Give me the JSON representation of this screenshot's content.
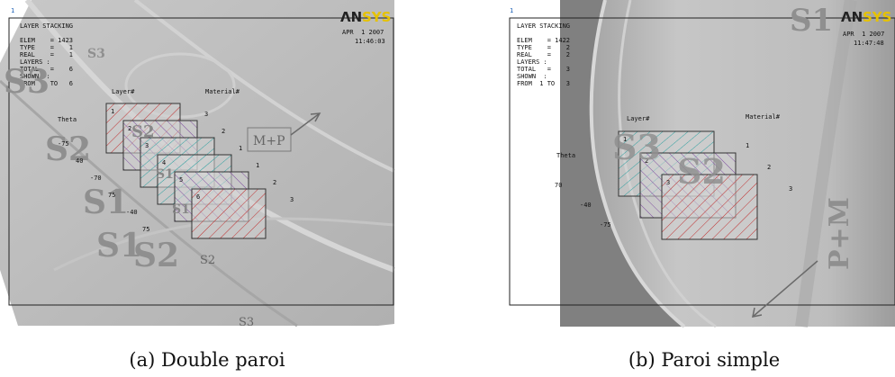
{
  "panels": [
    {
      "caption": "(a)  Double paroi",
      "header": {
        "index": "1",
        "title": "LAYER STACKING",
        "lines": [
          "ELEM    = 1423",
          "TYPE    =    1",
          "REAL    =    1",
          "LAYERS :",
          "TOTAL   =    6",
          "SHOWN  :",
          "FROM  1 TO   6"
        ],
        "date": "APR  1 2007",
        "time": "11:46:03",
        "logo_main": "ΛN",
        "logo_accent": "SYS"
      },
      "column_labels": {
        "layer": "Layer#",
        "material": "Material#",
        "theta": "Theta"
      },
      "layers": [
        {
          "num": "1",
          "material": "3",
          "theta": "-75",
          "color": "#c03030"
        },
        {
          "num": "2",
          "material": "2",
          "theta": "40",
          "color": "#a04080"
        },
        {
          "num": "3",
          "material": "1",
          "theta": "-70",
          "color": "#30a080"
        },
        {
          "num": "4",
          "material": "1",
          "theta": "75",
          "color": "#30a0a0"
        },
        {
          "num": "5",
          "material": "2",
          "theta": "-40",
          "color": "#8050a0"
        },
        {
          "num": "6",
          "material": "3",
          "theta": "75",
          "color": "#c03030"
        }
      ],
      "overlay_labels": [
        "S3",
        "S3",
        "S2",
        "S2",
        "S1",
        "S1",
        "S1",
        "S1",
        "S2",
        "S2",
        "S3"
      ],
      "annotation": "M+P"
    },
    {
      "caption": "(b)  Paroi simple",
      "header": {
        "index": "1",
        "title": "LAYER STACKING",
        "lines": [
          "ELEM    = 1422",
          "TYPE    =    2",
          "REAL    =    2",
          "LAYERS :",
          "TOTAL   =    3",
          "SHOWN  :",
          "FROM  1 TO   3"
        ],
        "date": "APR  1 2007",
        "time": "11:47:48",
        "logo_main": "ΛN",
        "logo_accent": "SYS"
      },
      "column_labels": {
        "layer": "Layer#",
        "material": "Material#",
        "theta": "Theta"
      },
      "layers": [
        {
          "num": "1",
          "material": "1",
          "theta": "70",
          "color": "#30a0a0"
        },
        {
          "num": "2",
          "material": "2",
          "theta": "-40",
          "color": "#8050a0"
        },
        {
          "num": "3",
          "material": "3",
          "theta": "-75",
          "color": "#c03030"
        }
      ],
      "overlay_labels": [
        "S1",
        "S3",
        "S2"
      ],
      "annotation": "P+M"
    }
  ]
}
